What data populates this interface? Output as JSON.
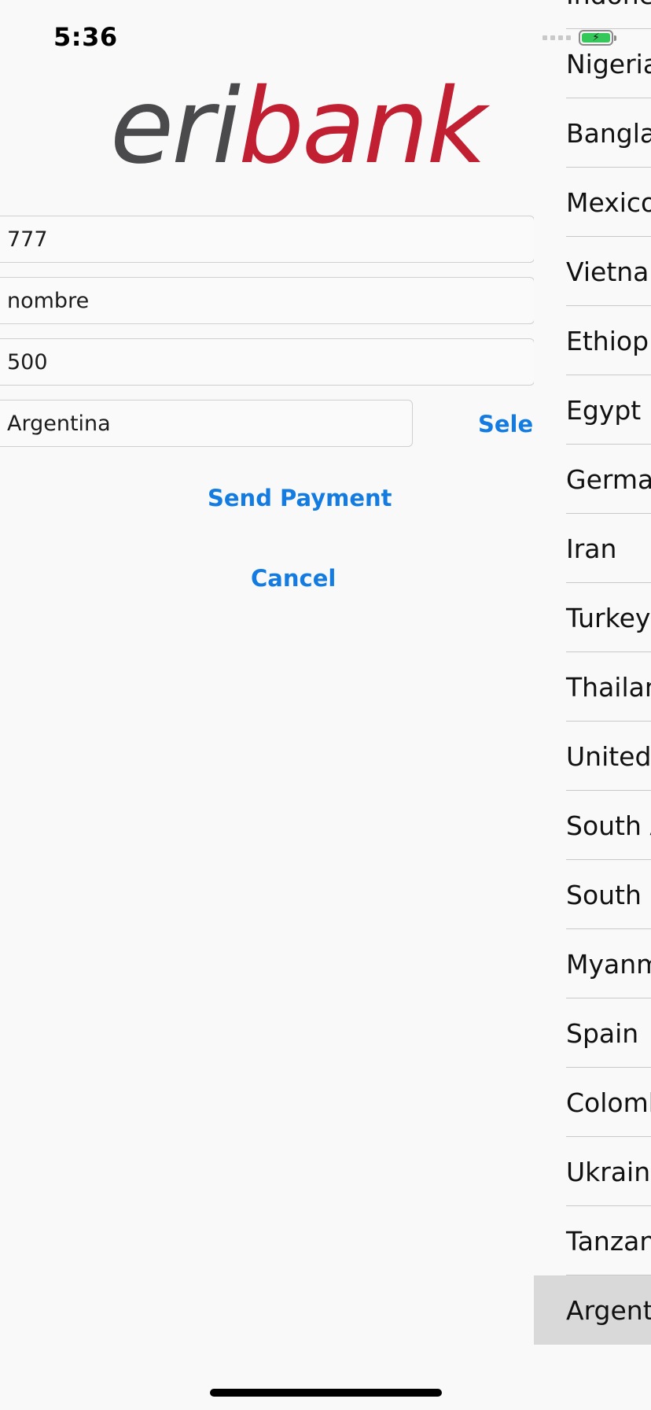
{
  "status_bar": {
    "time": "5:36"
  },
  "logo": {
    "part1": "eri",
    "part2": "bank",
    "color_part1": "#4a4a4c",
    "color_part2": "#c11f32"
  },
  "form": {
    "account_number_value": "777",
    "name_value": "nombre",
    "amount_value": "500",
    "country_value": "Argentina",
    "select_label": "Select",
    "send_payment_label": "Send Payment",
    "cancel_label": "Cancel"
  },
  "country_picker": {
    "items": [
      "Indonesia",
      "Nigeria",
      "Bangladesh",
      "Mexico",
      "Vietnam",
      "Ethiopia",
      "Egypt",
      "Germany",
      "Iran",
      "Turkey",
      "Thailand",
      "United Kingdom",
      "South Africa",
      "South Korea",
      "Myanmar",
      "Spain",
      "Colombia",
      "Ukraine",
      "Tanzania",
      "Argentina"
    ],
    "selected": "Argentina"
  },
  "colors": {
    "accent": "#147ce0",
    "background": "#f9f9f9",
    "selected_row": "#d9d9d9",
    "battery": "#35c759"
  }
}
